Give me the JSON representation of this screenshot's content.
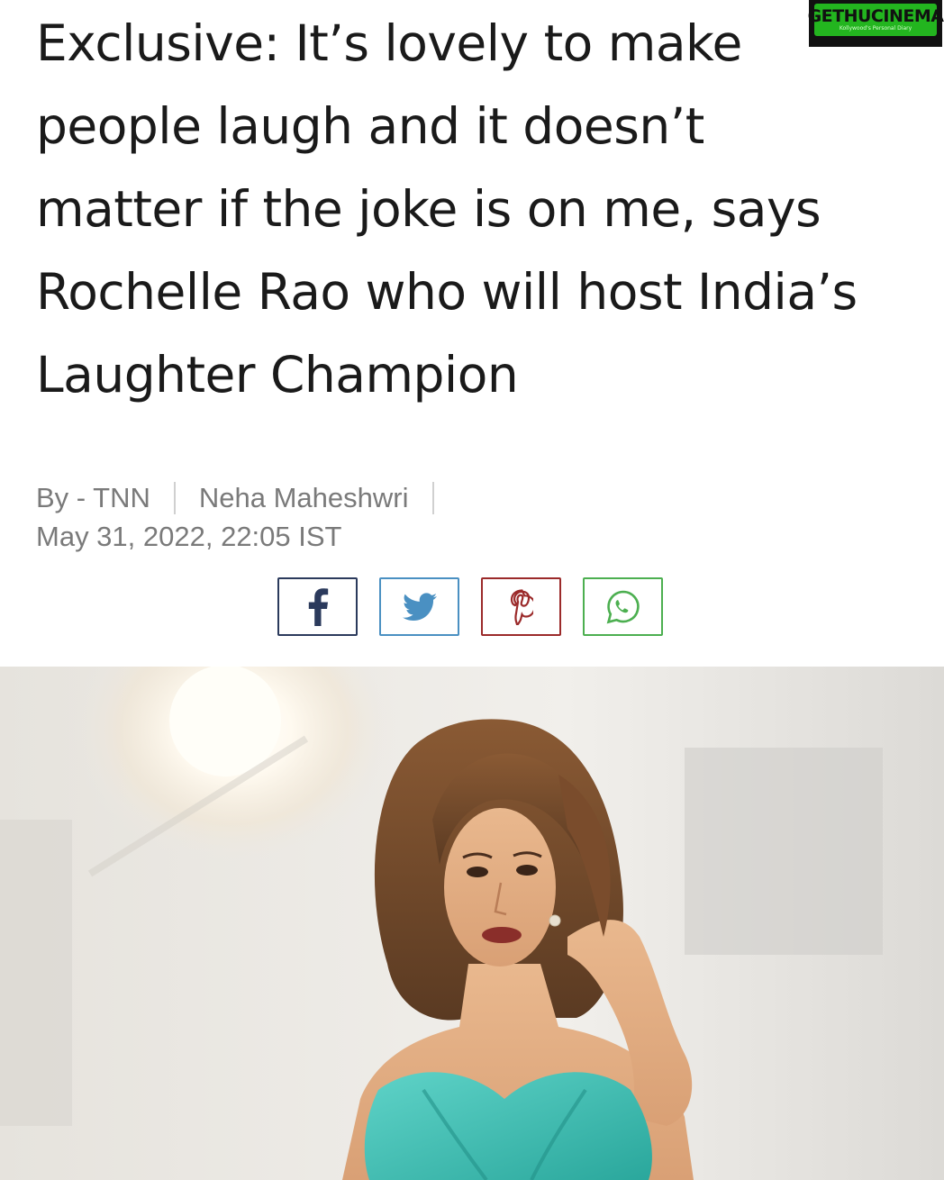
{
  "article": {
    "headline": "Exclusive: It’s lovely to make people laugh and it doesn’t matter if the joke is on me, says Rochelle Rao who will host India’s Laughter Champion",
    "byline_prefix": "By - TNN",
    "author": "Neha Maheshwri",
    "timestamp": "May 31, 2022, 22:05 IST"
  },
  "share": {
    "facebook": "facebook-icon",
    "twitter": "twitter-icon",
    "pinterest": "pinterest-icon",
    "whatsapp": "whatsapp-icon"
  },
  "watermark": {
    "brand": "GETHUCINEMA",
    "tagline": "Kollywood's Personal Diary"
  },
  "colors": {
    "facebook": "#2b3a5c",
    "twitter": "#4a90c2",
    "pinterest": "#9b2a2a",
    "whatsapp": "#4caf50",
    "dress": "#3fbfb6"
  }
}
